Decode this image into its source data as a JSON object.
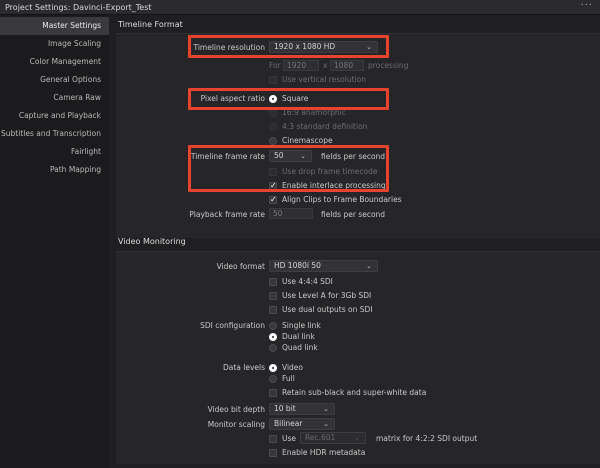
{
  "window": {
    "title": "Project Settings:  Davinci-Export_Test",
    "menu_label": "···"
  },
  "sidebar": {
    "items": [
      {
        "label": "Master Settings",
        "active": true
      },
      {
        "label": "Image Scaling"
      },
      {
        "label": "Color Management"
      },
      {
        "label": "General Options"
      },
      {
        "label": "Camera Raw"
      },
      {
        "label": "Capture and Playback"
      },
      {
        "label": "Subtitles and Transcription"
      },
      {
        "label": "Fairlight"
      },
      {
        "label": "Path Mapping"
      }
    ]
  },
  "timeline_format": {
    "header": "Timeline Format",
    "resolution_label": "Timeline resolution",
    "resolution_value": "1920 x 1080 HD",
    "for_label": "For",
    "width": "1920",
    "x_label": "x",
    "height": "1080",
    "processing_label": "processing",
    "use_vertical_label": "Use vertical resolution",
    "par_label": "Pixel aspect ratio",
    "par_options": [
      "Square",
      "16:9 anamorphic",
      "4:3 standard definition",
      "Cinemascope"
    ],
    "frame_rate_label": "Timeline frame rate",
    "frame_rate_value": "50",
    "fps_label": "fields per second",
    "drop_frame_label": "Use drop frame timecode",
    "interlace_label": "Enable interlace processing",
    "align_clips_label": "Align Clips to Frame Boundaries",
    "playback_label": "Playback frame rate",
    "playback_value": "50",
    "playback_fps_label": "fields per second"
  },
  "video_monitoring": {
    "header": "Video Monitoring",
    "format_label": "Video format",
    "format_value": "HD 1080i 50",
    "use_444_label": "Use 4:4:4 SDI",
    "use_level_a_label": "Use Level A for 3Gb SDI",
    "use_dual_label": "Use dual outputs on SDI",
    "sdi_label": "SDI configuration",
    "sdi_options": [
      "Single link",
      "Dual link",
      "Quad link"
    ],
    "data_levels_label": "Data levels",
    "data_levels_options": [
      "Video",
      "Full"
    ],
    "retain_label": "Retain sub-black and super-white data",
    "bit_depth_label": "Video bit depth",
    "bit_depth_value": "10 bit",
    "scaling_label": "Monitor scaling",
    "scaling_value": "Bilinear",
    "use_label": "Use",
    "matrix_value": "Rec.601",
    "matrix_suffix": "matrix for 4:2:2 SDI output",
    "hdr_label": "Enable HDR metadata"
  },
  "colors": {
    "highlight": "#e8432c",
    "background": "#1e1e20",
    "panel": "#262629"
  }
}
